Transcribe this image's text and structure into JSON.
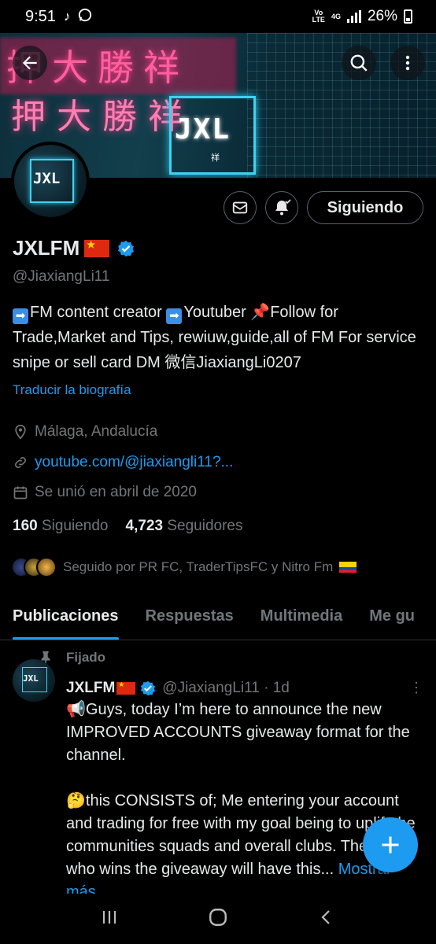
{
  "status_bar": {
    "time": "9:51",
    "network_top": "Vo",
    "network_bottom": "LTE",
    "gen": "4G",
    "battery": "26%"
  },
  "banner": {
    "neon_top": "押大勝祥",
    "neon_mid": "押大勝祥",
    "logo": "JXL",
    "logo_sub": "祥"
  },
  "profile": {
    "name": "JXLFM",
    "handle": "@JiaxiangLi11",
    "follow_label": "Siguiendo",
    "bio_1": "FM content creator ",
    "bio_2": "Youtuber ",
    "bio_3": "Follow for Trade,Market and Tips, rewiuw,guide,all of FM For service snipe or sell card DM 微信JiaxiangLi0207",
    "translate": "Traducir la biografía",
    "location": "Málaga, Andalucía",
    "link": "youtube.com/@jiaxiangli11?...",
    "joined": "Se unió en abril de 2020",
    "following_count": "160",
    "following_label": "Siguiendo",
    "followers_count": "4,723",
    "followers_label": "Seguidores",
    "followed_by": "Seguido por PR FC, TraderTipsFC y Nitro Fm"
  },
  "tabs": [
    "Publicaciones",
    "Respuestas",
    "Multimedia",
    "Me gu"
  ],
  "tweet": {
    "pinned": "Fijado",
    "name": "JXLFM",
    "handle": "@JiaxiangLi11 · 1d",
    "body": "📢Guys, today I’m here to announce the new IMPROVED ACCOUNTS giveaway format for the channel.\n\n🤔this CONSISTS of; Me entering your account and trading for free with my goal being to uplift the communities squads and overall clubs. The one who wins the giveaway will have this...",
    "show_more": "Mostrar más"
  },
  "colors": {
    "accent": "#1d9bf0",
    "muted": "#71767b",
    "text": "#e7e9ea"
  }
}
